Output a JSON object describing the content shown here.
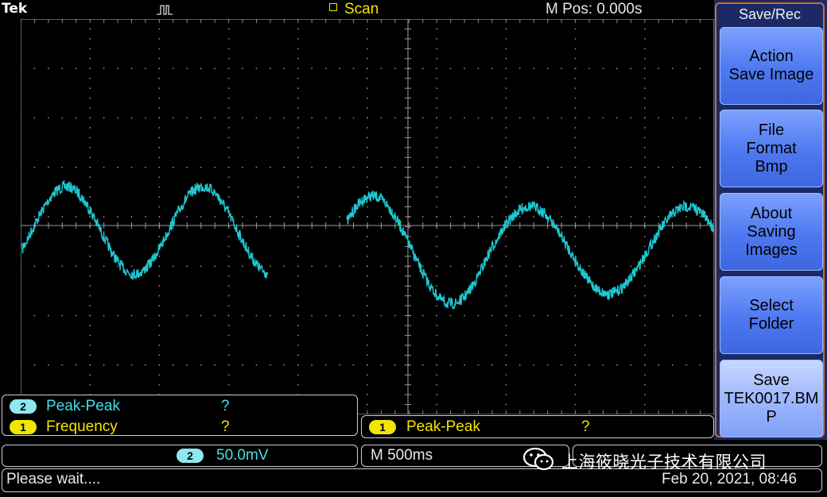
{
  "header": {
    "brand": "Tek",
    "acq_mode": "Scan",
    "m_pos": "M Pos: 0.000s"
  },
  "menu": {
    "title": "Save/Rec",
    "buttons": [
      {
        "label": "Action\nSave Image"
      },
      {
        "label": "File\nFormat\nBmp"
      },
      {
        "label": "About\nSaving\nImages"
      },
      {
        "label": "Select\nFolder"
      },
      {
        "label": "Save\nTEK0017.BM\nP"
      }
    ]
  },
  "measurements": {
    "left": [
      {
        "channel": "2",
        "name": "Peak-Peak",
        "value": "?"
      },
      {
        "channel": "1",
        "name": "Frequency",
        "value": "?"
      }
    ],
    "right": [
      {
        "channel": "1",
        "name": "Peak-Peak",
        "value": "?"
      }
    ]
  },
  "settings": {
    "ch2_channel": "2",
    "ch2_scale": "50.0mV",
    "timebase": "M 500ms"
  },
  "status": {
    "message": "Please wait....",
    "datetime": "Feb 20, 2021, 08:46"
  },
  "watermark": {
    "text": "上海筱晓光子技术有限公司"
  },
  "colors": {
    "trace": "#1ec8d2",
    "menu_frame": "#d46b1e",
    "accent_yellow": "#f2e600"
  }
}
